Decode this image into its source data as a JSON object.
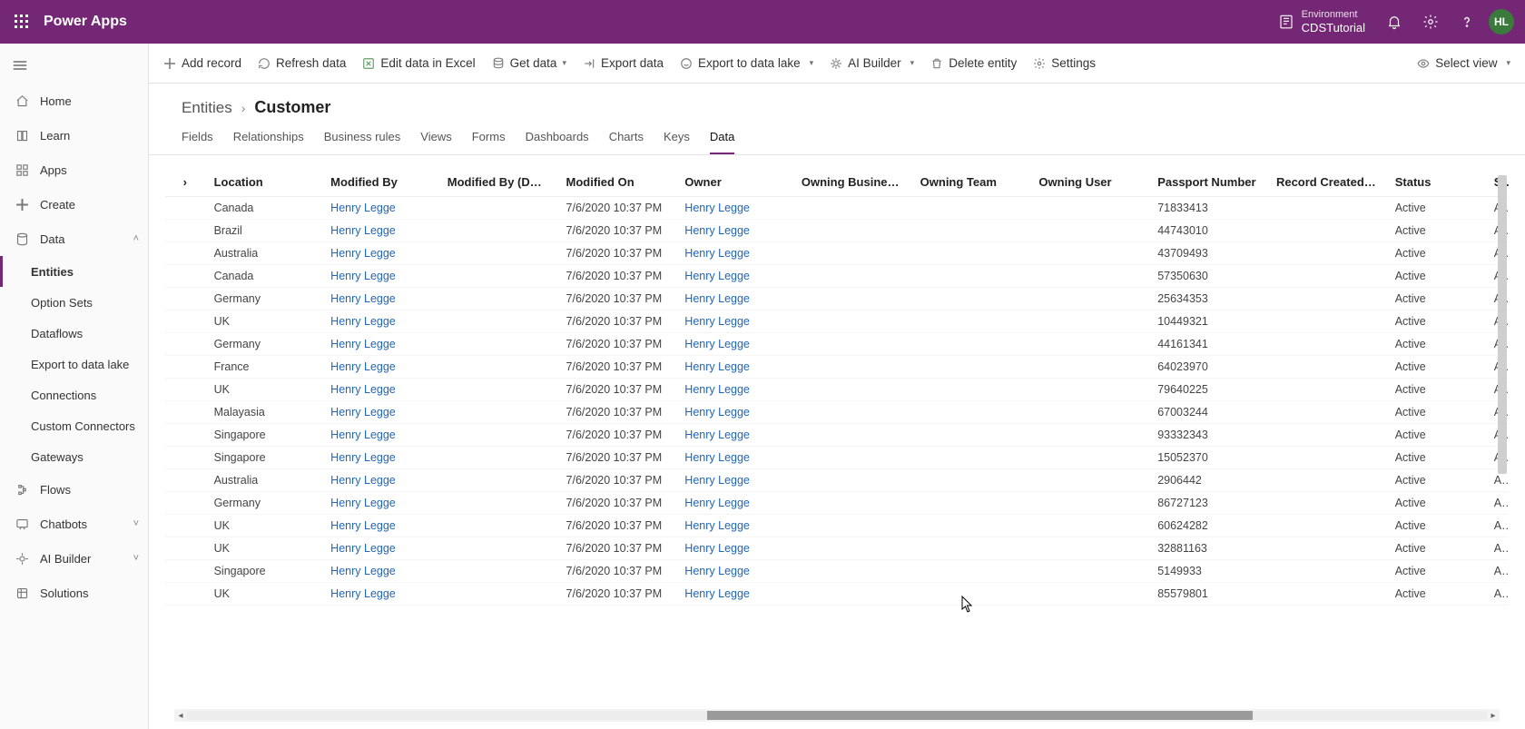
{
  "header": {
    "app_title": "Power Apps",
    "env_label": "Environment",
    "env_name": "CDSTutorial",
    "avatar_initials": "HL"
  },
  "left_nav": {
    "items": [
      {
        "icon": "home-icon",
        "label": "Home"
      },
      {
        "icon": "learn-icon",
        "label": "Learn"
      },
      {
        "icon": "apps-icon",
        "label": "Apps"
      },
      {
        "icon": "create-icon",
        "label": "Create"
      },
      {
        "icon": "data-icon",
        "label": "Data",
        "expanded": true,
        "children": [
          {
            "label": "Entities",
            "active": true
          },
          {
            "label": "Option Sets"
          },
          {
            "label": "Dataflows"
          },
          {
            "label": "Export to data lake"
          },
          {
            "label": "Connections"
          },
          {
            "label": "Custom Connectors"
          },
          {
            "label": "Gateways"
          }
        ]
      },
      {
        "icon": "flows-icon",
        "label": "Flows"
      },
      {
        "icon": "chatbots-icon",
        "label": "Chatbots",
        "chevron": true
      },
      {
        "icon": "ai-icon",
        "label": "AI Builder",
        "chevron": true
      },
      {
        "icon": "solutions-icon",
        "label": "Solutions"
      }
    ]
  },
  "command_bar": {
    "add_record": "Add record",
    "refresh": "Refresh data",
    "edit_excel": "Edit data in Excel",
    "get_data": "Get data",
    "export_data": "Export data",
    "export_lake": "Export to data lake",
    "ai_builder": "AI Builder",
    "delete_entity": "Delete entity",
    "settings": "Settings",
    "select_view": "Select view"
  },
  "breadcrumb": {
    "root": "Entities",
    "leaf": "Customer"
  },
  "tabs": [
    "Fields",
    "Relationships",
    "Business rules",
    "Views",
    "Forms",
    "Dashboards",
    "Charts",
    "Keys",
    "Data"
  ],
  "grid": {
    "columns": [
      "Location",
      "Modified By",
      "Modified By (Del...",
      "Modified On",
      "Owner",
      "Owning Business...",
      "Owning Team",
      "Owning User",
      "Passport Number",
      "Record Created ...",
      "Status",
      "S"
    ],
    "rows": [
      {
        "location": "Canada",
        "modby": "Henry Legge",
        "modbyd": "",
        "modon": "7/6/2020 10:37 PM",
        "owner": "Henry Legge",
        "obu": "",
        "oteam": "",
        "ouser": "",
        "passport": "71833413",
        "rec": "",
        "status": "Active",
        "s": "A"
      },
      {
        "location": "Brazil",
        "modby": "Henry Legge",
        "modbyd": "",
        "modon": "7/6/2020 10:37 PM",
        "owner": "Henry Legge",
        "obu": "",
        "oteam": "",
        "ouser": "",
        "passport": "44743010",
        "rec": "",
        "status": "Active",
        "s": "A"
      },
      {
        "location": "Australia",
        "modby": "Henry Legge",
        "modbyd": "",
        "modon": "7/6/2020 10:37 PM",
        "owner": "Henry Legge",
        "obu": "",
        "oteam": "",
        "ouser": "",
        "passport": "43709493",
        "rec": "",
        "status": "Active",
        "s": "A"
      },
      {
        "location": "Canada",
        "modby": "Henry Legge",
        "modbyd": "",
        "modon": "7/6/2020 10:37 PM",
        "owner": "Henry Legge",
        "obu": "",
        "oteam": "",
        "ouser": "",
        "passport": "57350630",
        "rec": "",
        "status": "Active",
        "s": "A"
      },
      {
        "location": "Germany",
        "modby": "Henry Legge",
        "modbyd": "",
        "modon": "7/6/2020 10:37 PM",
        "owner": "Henry Legge",
        "obu": "",
        "oteam": "",
        "ouser": "",
        "passport": "25634353",
        "rec": "",
        "status": "Active",
        "s": "A"
      },
      {
        "location": "UK",
        "modby": "Henry Legge",
        "modbyd": "",
        "modon": "7/6/2020 10:37 PM",
        "owner": "Henry Legge",
        "obu": "",
        "oteam": "",
        "ouser": "",
        "passport": "10449321",
        "rec": "",
        "status": "Active",
        "s": "A"
      },
      {
        "location": "Germany",
        "modby": "Henry Legge",
        "modbyd": "",
        "modon": "7/6/2020 10:37 PM",
        "owner": "Henry Legge",
        "obu": "",
        "oteam": "",
        "ouser": "",
        "passport": "44161341",
        "rec": "",
        "status": "Active",
        "s": "A"
      },
      {
        "location": "France",
        "modby": "Henry Legge",
        "modbyd": "",
        "modon": "7/6/2020 10:37 PM",
        "owner": "Henry Legge",
        "obu": "",
        "oteam": "",
        "ouser": "",
        "passport": "64023970",
        "rec": "",
        "status": "Active",
        "s": "A"
      },
      {
        "location": "UK",
        "modby": "Henry Legge",
        "modbyd": "",
        "modon": "7/6/2020 10:37 PM",
        "owner": "Henry Legge",
        "obu": "",
        "oteam": "",
        "ouser": "",
        "passport": "79640225",
        "rec": "",
        "status": "Active",
        "s": "A"
      },
      {
        "location": "Malayasia",
        "modby": "Henry Legge",
        "modbyd": "",
        "modon": "7/6/2020 10:37 PM",
        "owner": "Henry Legge",
        "obu": "",
        "oteam": "",
        "ouser": "",
        "passport": "67003244",
        "rec": "",
        "status": "Active",
        "s": "A"
      },
      {
        "location": "Singapore",
        "modby": "Henry Legge",
        "modbyd": "",
        "modon": "7/6/2020 10:37 PM",
        "owner": "Henry Legge",
        "obu": "",
        "oteam": "",
        "ouser": "",
        "passport": "93332343",
        "rec": "",
        "status": "Active",
        "s": "A"
      },
      {
        "location": "Singapore",
        "modby": "Henry Legge",
        "modbyd": "",
        "modon": "7/6/2020 10:37 PM",
        "owner": "Henry Legge",
        "obu": "",
        "oteam": "",
        "ouser": "",
        "passport": "15052370",
        "rec": "",
        "status": "Active",
        "s": "A"
      },
      {
        "location": "Australia",
        "modby": "Henry Legge",
        "modbyd": "",
        "modon": "7/6/2020 10:37 PM",
        "owner": "Henry Legge",
        "obu": "",
        "oteam": "",
        "ouser": "",
        "passport": "2906442",
        "rec": "",
        "status": "Active",
        "s": "A"
      },
      {
        "location": "Germany",
        "modby": "Henry Legge",
        "modbyd": "",
        "modon": "7/6/2020 10:37 PM",
        "owner": "Henry Legge",
        "obu": "",
        "oteam": "",
        "ouser": "",
        "passport": "86727123",
        "rec": "",
        "status": "Active",
        "s": "A"
      },
      {
        "location": "UK",
        "modby": "Henry Legge",
        "modbyd": "",
        "modon": "7/6/2020 10:37 PM",
        "owner": "Henry Legge",
        "obu": "",
        "oteam": "",
        "ouser": "",
        "passport": "60624282",
        "rec": "",
        "status": "Active",
        "s": "A"
      },
      {
        "location": "UK",
        "modby": "Henry Legge",
        "modbyd": "",
        "modon": "7/6/2020 10:37 PM",
        "owner": "Henry Legge",
        "obu": "",
        "oteam": "",
        "ouser": "",
        "passport": "32881163",
        "rec": "",
        "status": "Active",
        "s": "A"
      },
      {
        "location": "Singapore",
        "modby": "Henry Legge",
        "modbyd": "",
        "modon": "7/6/2020 10:37 PM",
        "owner": "Henry Legge",
        "obu": "",
        "oteam": "",
        "ouser": "",
        "passport": "5149933",
        "rec": "",
        "status": "Active",
        "s": "A"
      },
      {
        "location": "UK",
        "modby": "Henry Legge",
        "modbyd": "",
        "modon": "7/6/2020 10:37 PM",
        "owner": "Henry Legge",
        "obu": "",
        "oteam": "",
        "ouser": "",
        "passport": "85579801",
        "rec": "",
        "status": "Active",
        "s": "A"
      }
    ]
  }
}
